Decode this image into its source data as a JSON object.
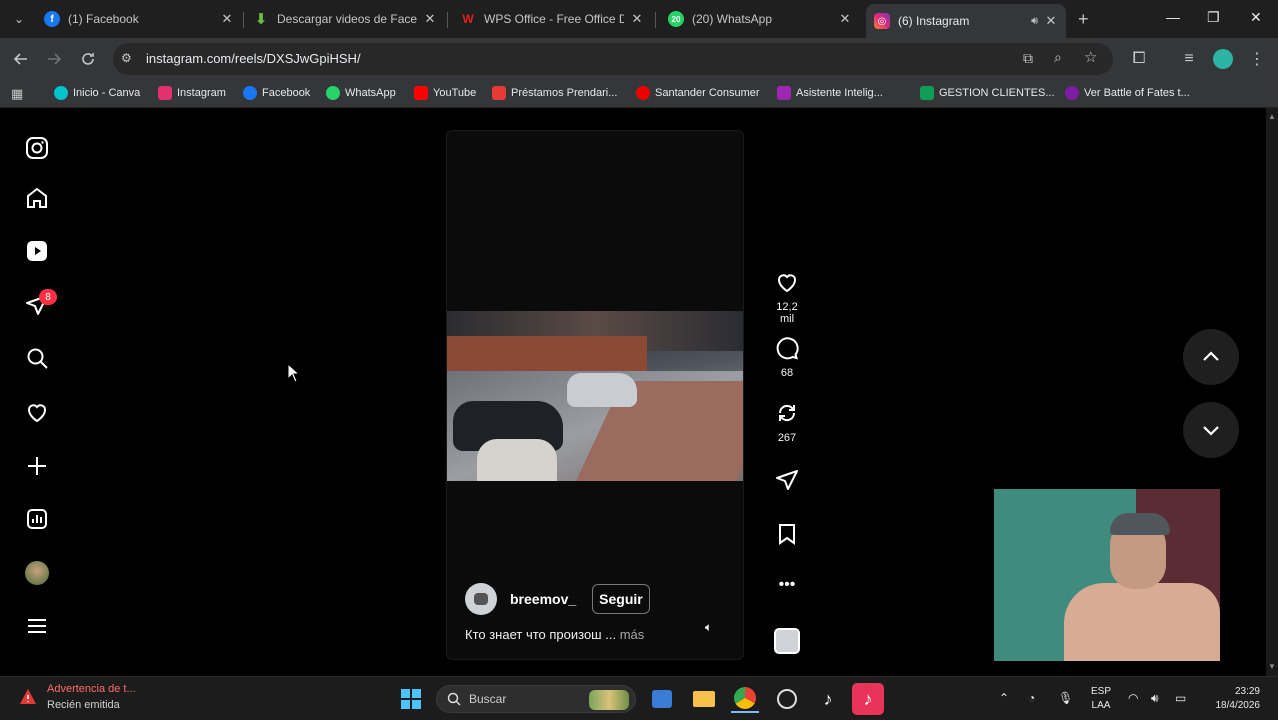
{
  "browser": {
    "tabs": [
      {
        "title": "(1) Facebook",
        "favicon": "facebook-icon",
        "color": "#1877f2",
        "active": false
      },
      {
        "title": "Descargar videos de Facebo",
        "favicon": "download-arrow-icon",
        "color": "#6cbd45",
        "active": false
      },
      {
        "title": "WPS Office - Free Office Do",
        "favicon": "wps-icon",
        "color": "#e02020",
        "active": false
      },
      {
        "title": "(20) WhatsApp",
        "favicon": "whatsapp-icon",
        "color": "#25d366",
        "active": false
      },
      {
        "title": "(6) Instagram",
        "favicon": "instagram-icon",
        "color": "#e1306c",
        "active": true
      }
    ],
    "url": "instagram.com/reels/DXSJwGpiHSH/",
    "bookmarks": [
      {
        "label": "Inicio - Canva",
        "color": "#00c4cc"
      },
      {
        "label": "Instagram",
        "color": "#e1306c"
      },
      {
        "label": "Facebook",
        "color": "#1877f2"
      },
      {
        "label": "WhatsApp",
        "color": "#25d366"
      },
      {
        "label": "YouTube",
        "color": "#ff0000"
      },
      {
        "label": "Préstamos Prendari...",
        "color": "#e53935"
      },
      {
        "label": "Santander Consumer",
        "color": "#ec0000"
      },
      {
        "label": "Asistente Intelig...",
        "color": "#9c27b0"
      },
      {
        "label": "GESTION CLIENTES...",
        "color": "#0f9d58"
      },
      {
        "label": "Ver Battle of Fates t...",
        "color": "#7b1fa2"
      }
    ]
  },
  "instagram": {
    "nav_badge": "8",
    "reel": {
      "username": "breemov_",
      "follow_label": "Seguir",
      "caption": "Кто знает что произош ...",
      "more_label": "más",
      "likes": "12,2 mil",
      "comments": "68",
      "reposts": "267"
    }
  },
  "taskbar": {
    "notification_title": "Advertencia de t...",
    "notification_sub": "Recién emitida",
    "search_placeholder": "Buscar",
    "lang_line1": "ESP",
    "lang_line2": "LAA",
    "time": "23:29",
    "date": "18/4/2026"
  }
}
